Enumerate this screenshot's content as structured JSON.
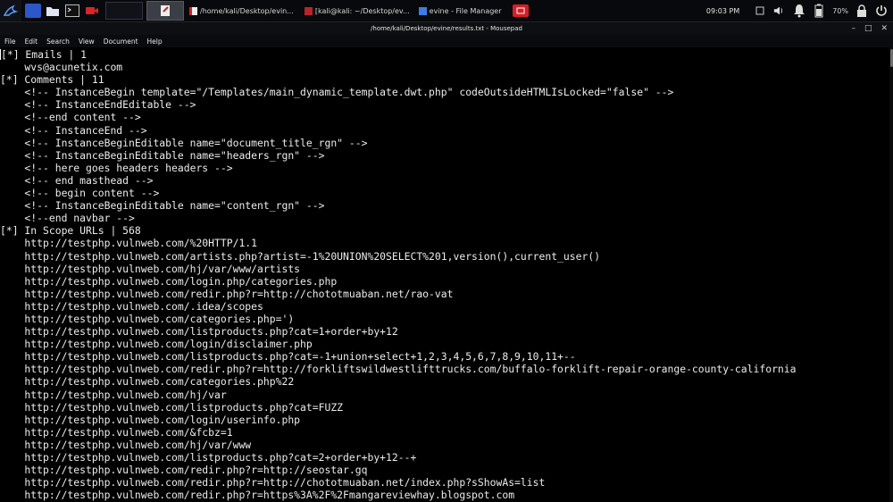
{
  "panel": {
    "window_tasks": [
      {
        "label": "/home/kali/Desktop/evin..."
      },
      {
        "label": "[kali@kali: ~/Desktop/ev..."
      },
      {
        "label": "evine - File Manager"
      }
    ],
    "clock": "09:03 PM",
    "battery": "70%",
    "icons": [
      "kali-dragon-icon",
      "workspace-icon",
      "folder-icon",
      "terminal-icon",
      "screen-recorder-icon",
      "window-icon",
      "volume-icon",
      "notification-bell-icon",
      "battery-icon",
      "lock-icon",
      "power-icon"
    ]
  },
  "window": {
    "title": "/home/kali/Desktop/evine/results.txt - Mousepad"
  },
  "menu": [
    "File",
    "Edit",
    "Search",
    "View",
    "Document",
    "Help"
  ],
  "editor": {
    "lines": [
      "[*] Emails | 1",
      "    wvs@acunetix.com",
      "[*] Comments | 11",
      "    <!-- InstanceBegin template=\"/Templates/main_dynamic_template.dwt.php\" codeOutsideHTMLIsLocked=\"false\" -->",
      "    <!-- InstanceEndEditable -->",
      "    <!--end content -->",
      "    <!-- InstanceEnd -->",
      "    <!-- InstanceBeginEditable name=\"document_title_rgn\" -->",
      "    <!-- InstanceBeginEditable name=\"headers_rgn\" -->",
      "    <!-- here goes headers headers -->",
      "    <!-- end masthead -->",
      "    <!-- begin content -->",
      "    <!-- InstanceBeginEditable name=\"content_rgn\" -->",
      "    <!--end navbar -->",
      "[*] In Scope URLs | 568",
      "    http://testphp.vulnweb.com/%20HTTP/1.1",
      "    http://testphp.vulnweb.com/artists.php?artist=-1%20UNION%20SELECT%201,version(),current_user()",
      "    http://testphp.vulnweb.com/hj/var/www/artists",
      "    http://testphp.vulnweb.com/login.php/categories.php",
      "    http://testphp.vulnweb.com/redir.php?r=http://chototmuaban.net/rao-vat",
      "    http://testphp.vulnweb.com/.idea/scopes",
      "    http://testphp.vulnweb.com/categories.php=')",
      "    http://testphp.vulnweb.com/listproducts.php?cat=1+order+by+12",
      "    http://testphp.vulnweb.com/login/disclaimer.php",
      "    http://testphp.vulnweb.com/listproducts.php?cat=-1+union+select+1,2,3,4,5,6,7,8,9,10,11+--",
      "    http://testphp.vulnweb.com/redir.php?r=http://forkliftswildwestlifttrucks.com/buffalo-forklift-repair-orange-county-california",
      "    http://testphp.vulnweb.com/categories.php%22",
      "    http://testphp.vulnweb.com/hj/var",
      "    http://testphp.vulnweb.com/listproducts.php?cat=FUZZ",
      "    http://testphp.vulnweb.com/login/userinfo.php",
      "    http://testphp.vulnweb.com/&fcbz=1",
      "    http://testphp.vulnweb.com/hj/var/www",
      "    http://testphp.vulnweb.com/listproducts.php?cat=2+order+by+12--+",
      "    http://testphp.vulnweb.com/redir.php?r=http://seostar.gq",
      "    http://testphp.vulnweb.com/redir.php?r=http://chototmuaban.net/index.php?sShowAs=list",
      "    http://testphp.vulnweb.com/redir.php?r=https%3A%2F%2Fmangareviewhay.blogspot.com"
    ]
  }
}
